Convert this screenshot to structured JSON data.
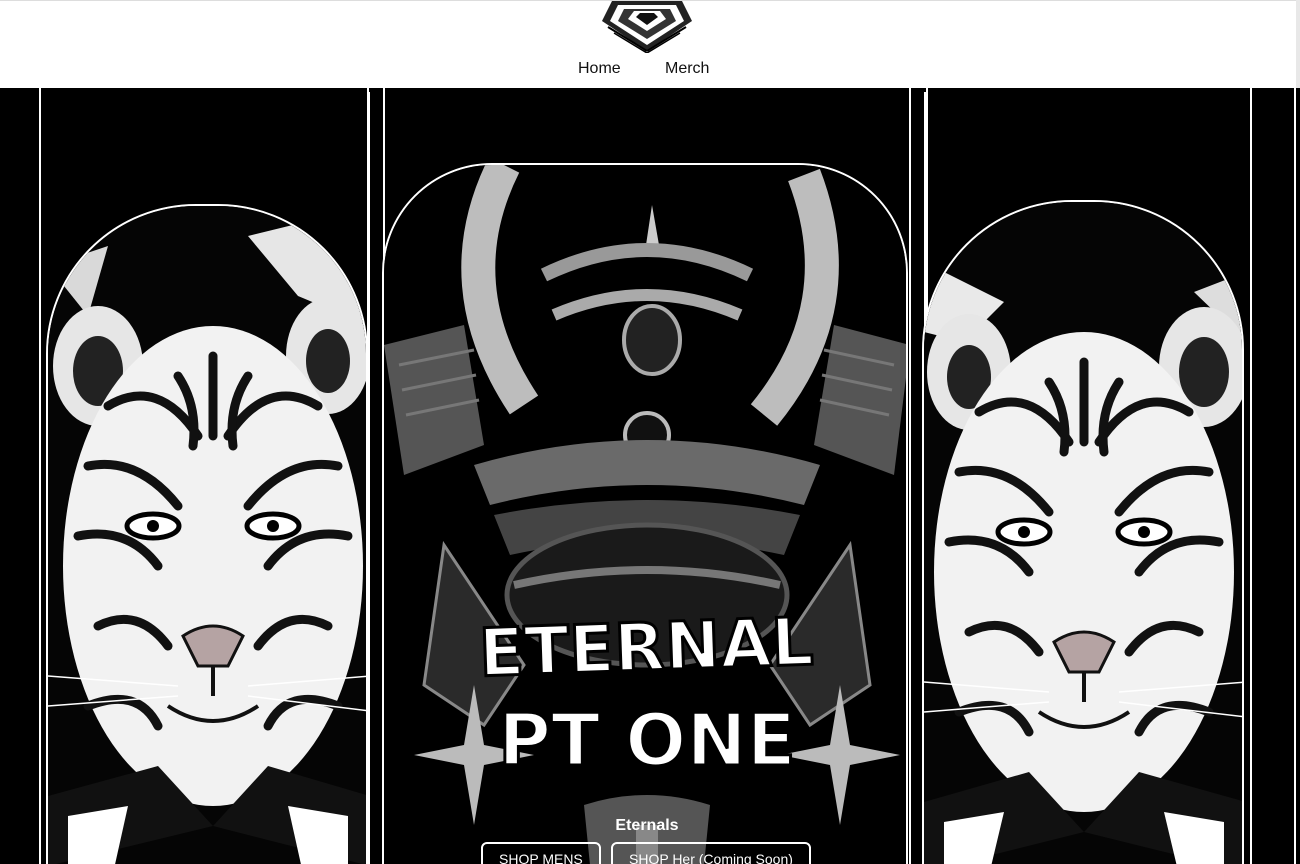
{
  "header": {
    "logo_icon": "samurai-tiger-logo-icon",
    "nav": [
      {
        "label": "Home"
      },
      {
        "label": "Merch"
      }
    ]
  },
  "hero": {
    "left_art": "tiger-face-illustration",
    "center_art": "samurai-helmet-illustration",
    "center_title_line1": "ETERNAL",
    "center_title_line2": "PT ONE",
    "right_art": "tiger-face-illustration",
    "caption": "Eternals",
    "buttons": [
      {
        "label": "SHOP MENS"
      },
      {
        "label": "SHOP Her (Coming Soon)"
      }
    ]
  },
  "colors": {
    "background": "#000000",
    "header_bg": "#ffffff",
    "accent": "#ffffff"
  }
}
